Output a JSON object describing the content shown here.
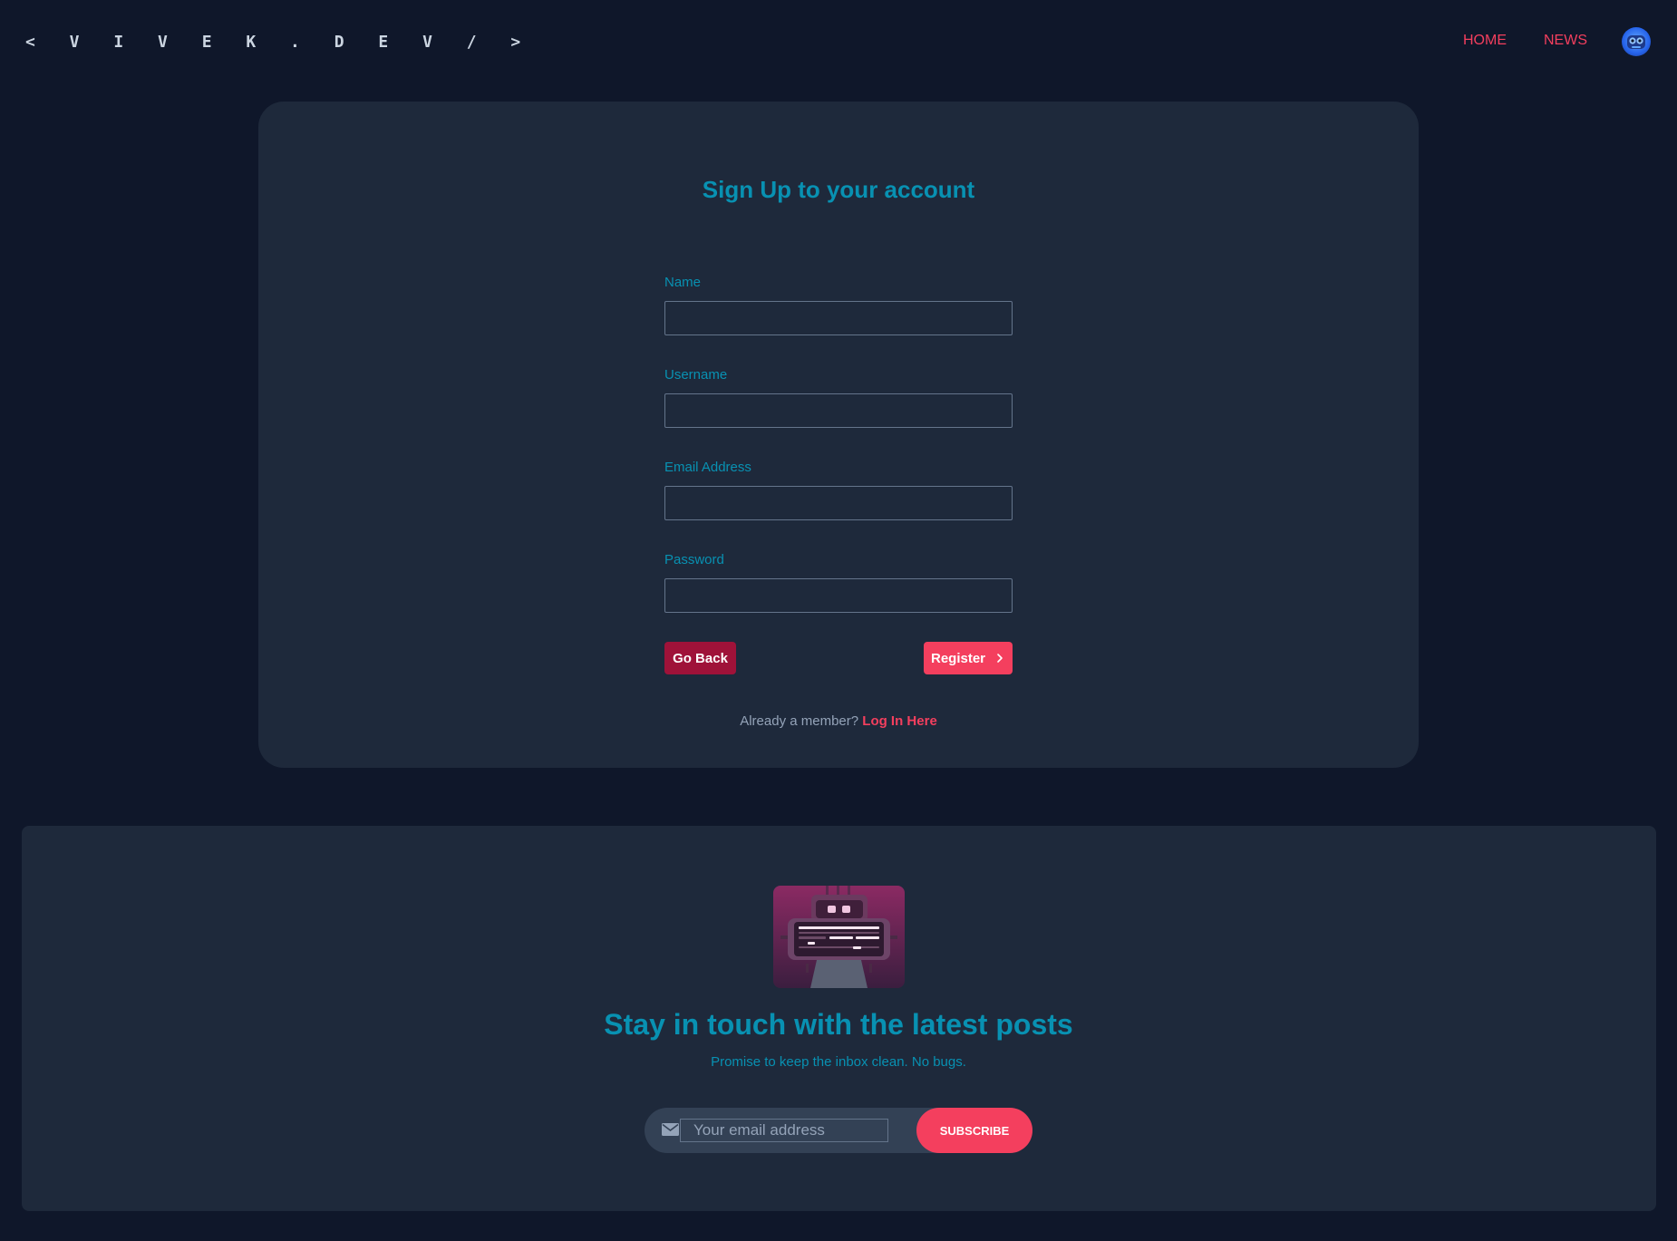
{
  "header": {
    "logo": "< V I V E K . D E V / >",
    "nav": [
      {
        "label": "HOME"
      },
      {
        "label": "NEWS"
      }
    ],
    "avatar_icon": "robot-avatar-icon"
  },
  "signup": {
    "title": "Sign Up to your account",
    "fields": [
      {
        "label": "Name",
        "value": "",
        "placeholder": ""
      },
      {
        "label": "Username",
        "value": "",
        "placeholder": ""
      },
      {
        "label": "Email Address",
        "value": "",
        "placeholder": ""
      },
      {
        "label": "Password",
        "value": "",
        "placeholder": ""
      }
    ],
    "back_label": "Go Back",
    "register_label": "Register",
    "member_text": "Already a member?",
    "login_label": "Log In Here"
  },
  "newsletter": {
    "title": "Stay in touch with the latest posts",
    "subtitle": "Promise to keep the inbox clean. No bugs.",
    "email_placeholder": "Your email address",
    "subscribe_label": "SUBSCRIBE"
  },
  "colors": {
    "background": "#0f172a",
    "card": "#1e293b",
    "accent": "#f43f5e",
    "accent_dark": "#9f1239",
    "teal": "#0891b2"
  }
}
